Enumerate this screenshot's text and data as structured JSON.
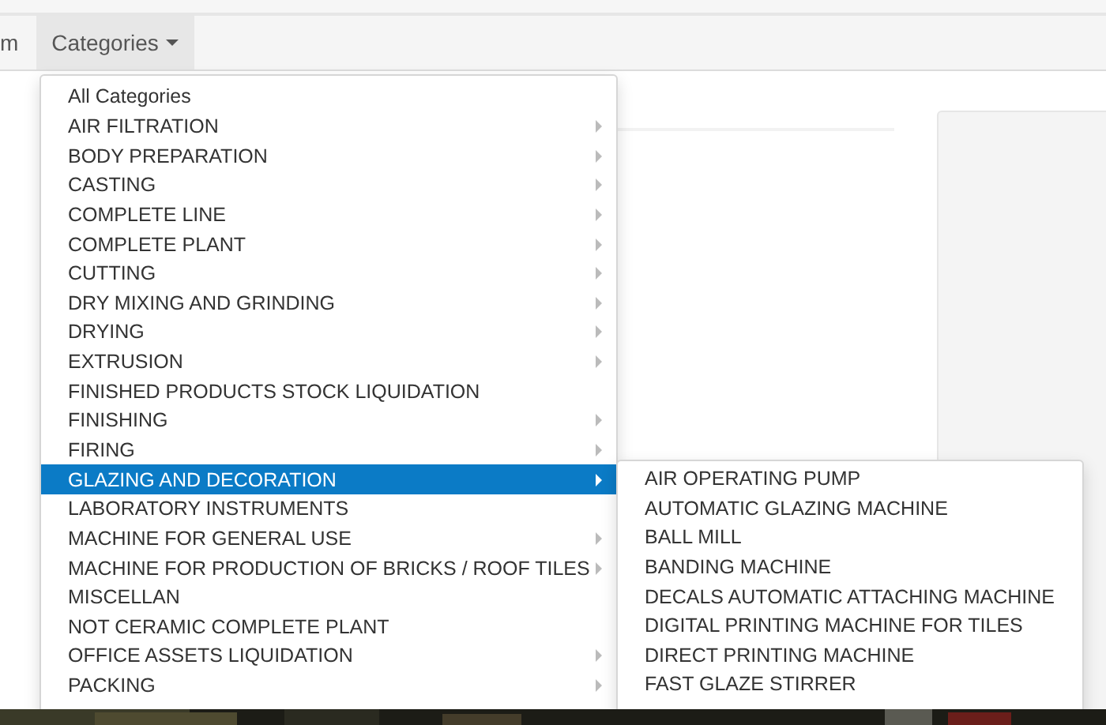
{
  "navbar": {
    "items": [
      {
        "label": "m",
        "selected": false,
        "dropdown": false
      },
      {
        "label": "Categories",
        "selected": true,
        "dropdown": true
      }
    ]
  },
  "categories_menu": {
    "items": [
      {
        "label": "All Categories",
        "has_submenu": false,
        "selected": false
      },
      {
        "label": "AIR FILTRATION",
        "has_submenu": true,
        "selected": false
      },
      {
        "label": "BODY PREPARATION",
        "has_submenu": true,
        "selected": false
      },
      {
        "label": "CASTING",
        "has_submenu": true,
        "selected": false
      },
      {
        "label": "COMPLETE LINE",
        "has_submenu": true,
        "selected": false
      },
      {
        "label": "COMPLETE PLANT",
        "has_submenu": true,
        "selected": false
      },
      {
        "label": "CUTTING",
        "has_submenu": true,
        "selected": false
      },
      {
        "label": "DRY MIXING AND GRINDING",
        "has_submenu": true,
        "selected": false
      },
      {
        "label": "DRYING",
        "has_submenu": true,
        "selected": false
      },
      {
        "label": "EXTRUSION",
        "has_submenu": true,
        "selected": false
      },
      {
        "label": "FINISHED PRODUCTS STOCK LIQUIDATION",
        "has_submenu": false,
        "selected": false
      },
      {
        "label": "FINISHING",
        "has_submenu": true,
        "selected": false
      },
      {
        "label": "FIRING",
        "has_submenu": true,
        "selected": false
      },
      {
        "label": "GLAZING AND DECORATION",
        "has_submenu": true,
        "selected": true
      },
      {
        "label": "LABORATORY INSTRUMENTS",
        "has_submenu": false,
        "selected": false
      },
      {
        "label": "MACHINE FOR GENERAL USE",
        "has_submenu": true,
        "selected": false
      },
      {
        "label": "MACHINE FOR PRODUCTION OF BRICKS / ROOF TILES",
        "has_submenu": true,
        "selected": false
      },
      {
        "label": "MISCELLAN",
        "has_submenu": false,
        "selected": false
      },
      {
        "label": "NOT CERAMIC COMPLETE PLANT",
        "has_submenu": false,
        "selected": false
      },
      {
        "label": "OFFICE ASSETS LIQUIDATION",
        "has_submenu": true,
        "selected": false
      },
      {
        "label": "PACKING",
        "has_submenu": true,
        "selected": false
      }
    ]
  },
  "submenu": {
    "items": [
      "AIR OPERATING PUMP",
      "AUTOMATIC GLAZING MACHINE",
      "BALL MILL",
      "BANDING MACHINE",
      "DECALS AUTOMATIC ATTACHING MACHINE",
      "DIGITAL PRINTING MACHINE FOR TILES",
      "DIRECT PRINTING MACHINE",
      "FAST GLAZE STIRRER"
    ]
  }
}
